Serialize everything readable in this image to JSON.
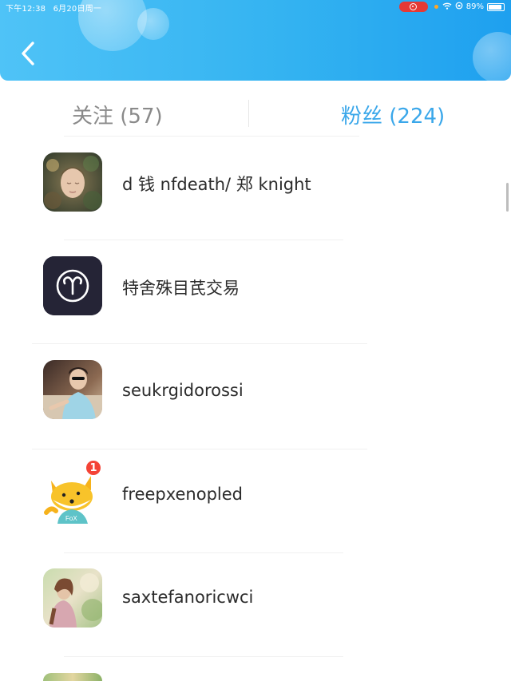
{
  "status_bar": {
    "time": "下午12:38",
    "date": "6月20日周一",
    "battery": "89%",
    "battery_level": 0.89
  },
  "header": {
    "back_icon": "chevron-left-icon"
  },
  "tabs": [
    {
      "label": "关注 (57)",
      "selected": false
    },
    {
      "label": "粉丝 (224)",
      "selected": true
    }
  ],
  "followers": [
    {
      "name": "d 钱 nfdeath/ 郑 knight",
      "avatar": "photo-portrait"
    },
    {
      "name": "特舍殊目芪交易",
      "avatar": "aries-zodiac-icon"
    },
    {
      "name": "seukrgidorossi",
      "avatar": "photo-person-sunglasses"
    },
    {
      "name": "freepxenopled",
      "avatar": "cartoon-fox",
      "badge": "1"
    },
    {
      "name": "saxtefanoricwci",
      "avatar": "photo-person-outdoor"
    }
  ],
  "colors": {
    "header_blue": "#34b3f1",
    "active_tab": "#3aa7ea",
    "inactive_tab": "#8a8a8a",
    "badge_red": "#f44336"
  }
}
